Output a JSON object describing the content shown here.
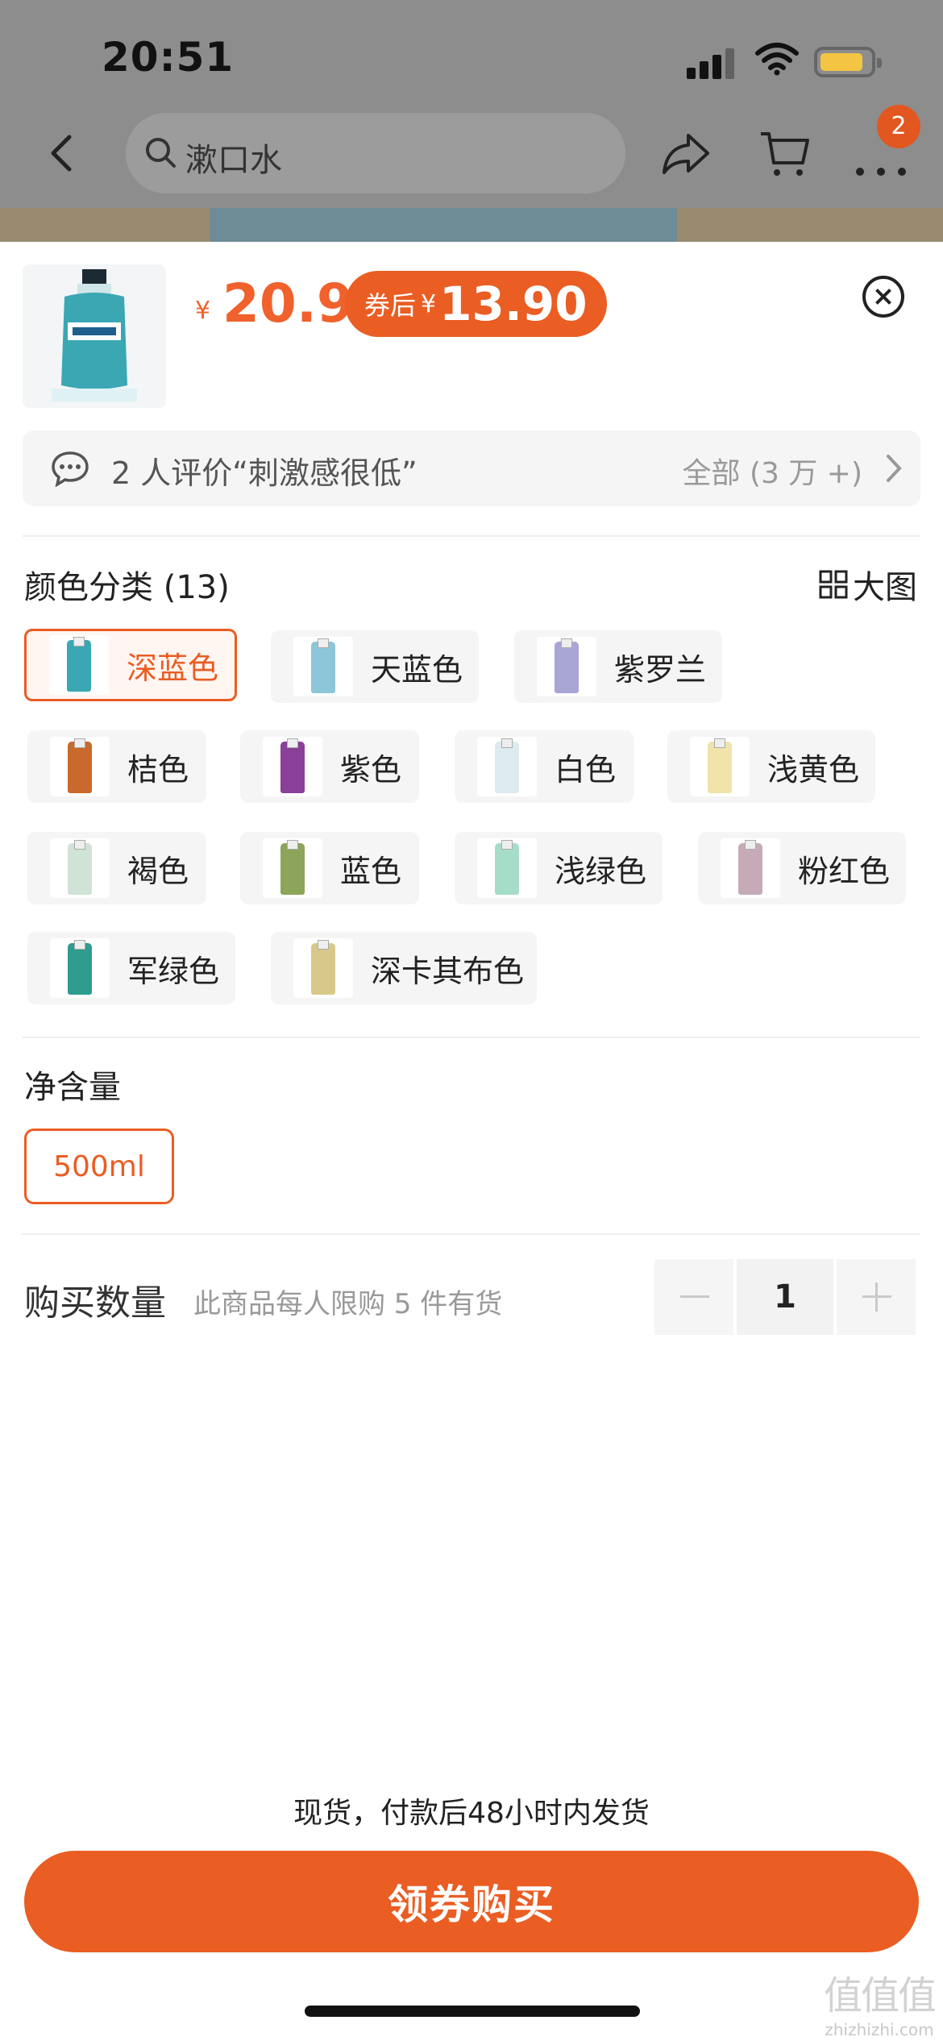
{
  "status_bar": {
    "time": "20:51"
  },
  "nav": {
    "search_text": "漱口水",
    "cart_badge": "2"
  },
  "product": {
    "price_symbol": "¥",
    "price": "20.9",
    "coupon_label": "券后",
    "coupon_symbol": "¥",
    "coupon_price": "13.90"
  },
  "review": {
    "text": "2 人评价“刺激感很低”",
    "all": "全部 (3 万 +)"
  },
  "color_section": {
    "title": "颜色分类 (13)",
    "big_image": "大图",
    "options": [
      {
        "label": "深蓝色",
        "selected": true,
        "color": "#3aa7b3"
      },
      {
        "label": "天蓝色",
        "selected": false,
        "color": "#8dc6d8"
      },
      {
        "label": "紫罗兰",
        "selected": false,
        "color": "#a9a6d6"
      },
      {
        "label": "桔色",
        "selected": false,
        "color": "#c9692b"
      },
      {
        "label": "紫色",
        "selected": false,
        "color": "#8a3f98"
      },
      {
        "label": "白色",
        "selected": false,
        "color": "#dcebf0"
      },
      {
        "label": "浅黄色",
        "selected": false,
        "color": "#f1e3a9"
      },
      {
        "label": "褐色",
        "selected": false,
        "color": "#cfe3d6"
      },
      {
        "label": "蓝色",
        "selected": false,
        "color": "#8ca55a"
      },
      {
        "label": "浅绿色",
        "selected": false,
        "color": "#a6ddc9"
      },
      {
        "label": "粉红色",
        "selected": false,
        "color": "#c6aab8"
      },
      {
        "label": "军绿色",
        "selected": false,
        "color": "#2f9c8f"
      },
      {
        "label": "深卡其布色",
        "selected": false,
        "color": "#d8c98a"
      }
    ]
  },
  "volume_section": {
    "title": "净含量",
    "option": "500ml"
  },
  "quantity": {
    "title": "购买数量",
    "note": "此商品每人限购 5 件有货",
    "value": "1"
  },
  "footer": {
    "ship_note": "现货，付款后48小时内发货",
    "buy_label": "领券购买"
  },
  "watermark": {
    "logo": "值值值",
    "domain": "zhizhizhi.com"
  }
}
